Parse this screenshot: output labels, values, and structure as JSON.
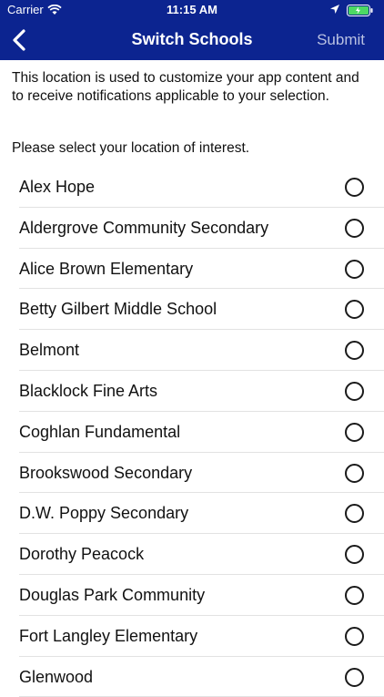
{
  "status_bar": {
    "carrier": "Carrier",
    "time": "11:15 AM"
  },
  "nav": {
    "title": "Switch Schools",
    "submit_label": "Submit"
  },
  "intro_text": "This location is used to customize your app content and to receive notifications applicable to your selection.",
  "prompt_text": "Please select your location of interest.",
  "schools": [
    "Alex Hope",
    "Aldergrove Community Secondary",
    "Alice Brown Elementary",
    "Betty Gilbert Middle School",
    "Belmont",
    "Blacklock Fine Arts",
    "Coghlan Fundamental",
    "Brookswood Secondary",
    "D.W. Poppy Secondary",
    "Dorothy Peacock",
    "Douglas Park Community",
    "Fort Langley Elementary",
    "Glenwood"
  ],
  "colors": {
    "nav_bg": "#0c2490",
    "submit_disabled": "#b9c1e2"
  }
}
